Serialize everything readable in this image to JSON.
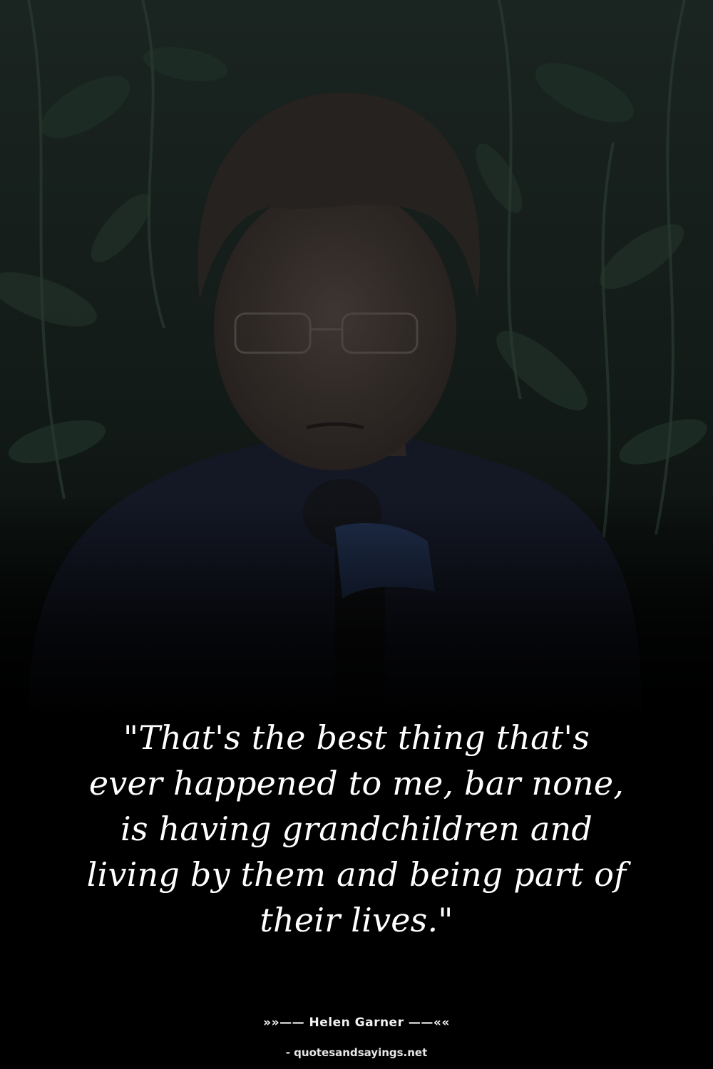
{
  "photo": {
    "subject": "photo of woman with glasses speaking into a microphone in front of foliage"
  },
  "quote": {
    "lines": [
      "\"That's the best thing that's",
      "ever happened to me, bar none,",
      "is having grandchildren and",
      "living by them and being part of",
      "their lives.\""
    ]
  },
  "attribution": {
    "author": "»»—— Helen Garner ——««"
  },
  "footer": {
    "source": "- quotesandsayings.net"
  },
  "colors": {
    "background": "#000000",
    "text": "#ffffff"
  }
}
